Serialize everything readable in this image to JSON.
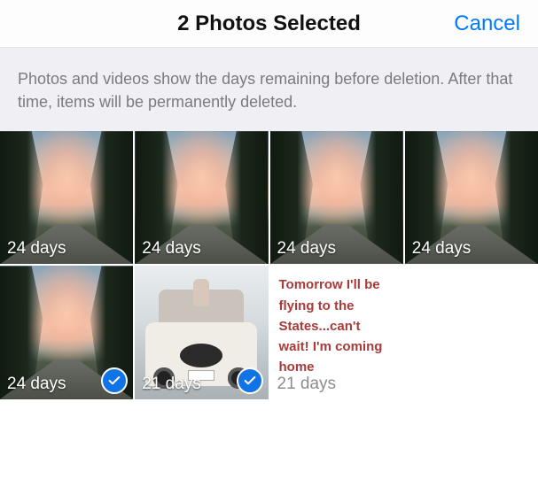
{
  "header": {
    "title": "2 Photos Selected",
    "cancel": "Cancel"
  },
  "info": "Photos and videos show the days remaining before deletion. After that time, items will be permanently deleted.",
  "photos": [
    {
      "days_label": "24 days",
      "kind": "sky",
      "selected": false
    },
    {
      "days_label": "24 days",
      "kind": "sky",
      "selected": false
    },
    {
      "days_label": "24 days",
      "kind": "sky",
      "selected": false
    },
    {
      "days_label": "24 days",
      "kind": "sky",
      "selected": false
    },
    {
      "days_label": "24 days",
      "kind": "sky",
      "selected": true
    },
    {
      "days_label": "21 days",
      "kind": "car",
      "selected": true
    },
    {
      "days_label": "21 days",
      "kind": "note",
      "selected": false,
      "note_text": "Tomorrow I'll be flying to the States...can't wait! I'm coming home"
    }
  ],
  "icons": {
    "checkmark": "checkmark-icon"
  }
}
